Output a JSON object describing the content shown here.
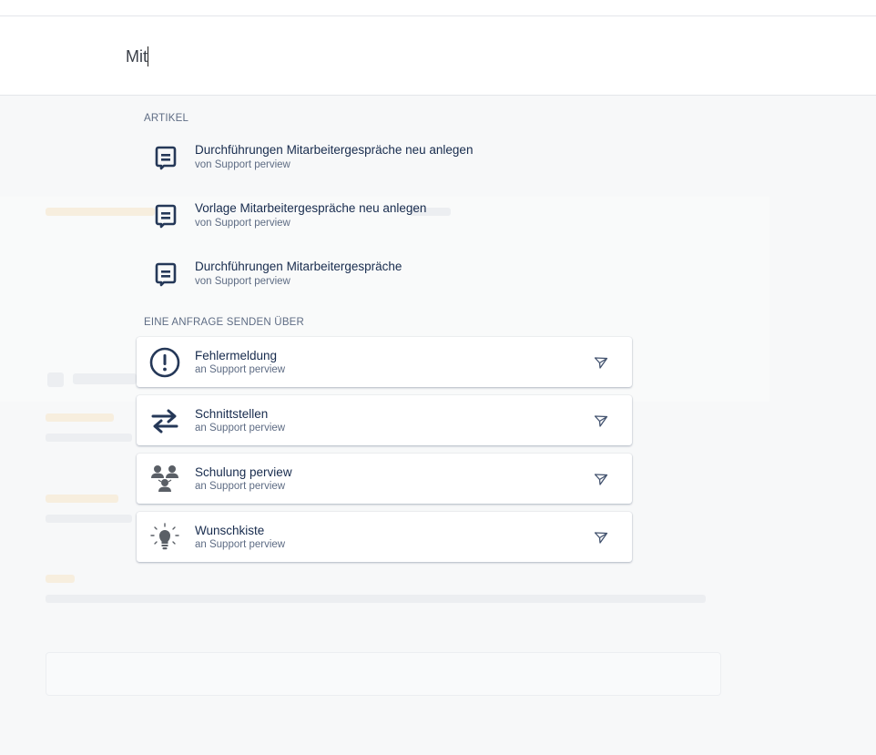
{
  "search": {
    "value": "Mit"
  },
  "articles": {
    "heading": "ARTIKEL",
    "items": [
      {
        "title": "Durchführungen Mitarbeitergespräche neu anlegen",
        "subtitle": "von Support perview"
      },
      {
        "title": "Vorlage Mitarbeitergespräche neu anlegen",
        "subtitle": "von Support perview"
      },
      {
        "title": "Durchführungen Mitarbeitergespräche",
        "subtitle": "von Support perview"
      }
    ]
  },
  "requests": {
    "heading": "EINE ANFRAGE SENDEN ÜBER",
    "items": [
      {
        "title": "Fehlermeldung",
        "subtitle": "an Support perview",
        "icon": "exclamation-circle-icon"
      },
      {
        "title": "Schnittstellen",
        "subtitle": "an Support perview",
        "icon": "swap-arrows-icon"
      },
      {
        "title": "Schulung perview",
        "subtitle": "an Support perview",
        "icon": "people-group-icon"
      },
      {
        "title": "Wunschkiste",
        "subtitle": "an Support perview",
        "icon": "lightbulb-icon"
      }
    ]
  },
  "colors": {
    "text": "#172b4d",
    "muted": "#5e6c84",
    "icon": "#253858"
  }
}
